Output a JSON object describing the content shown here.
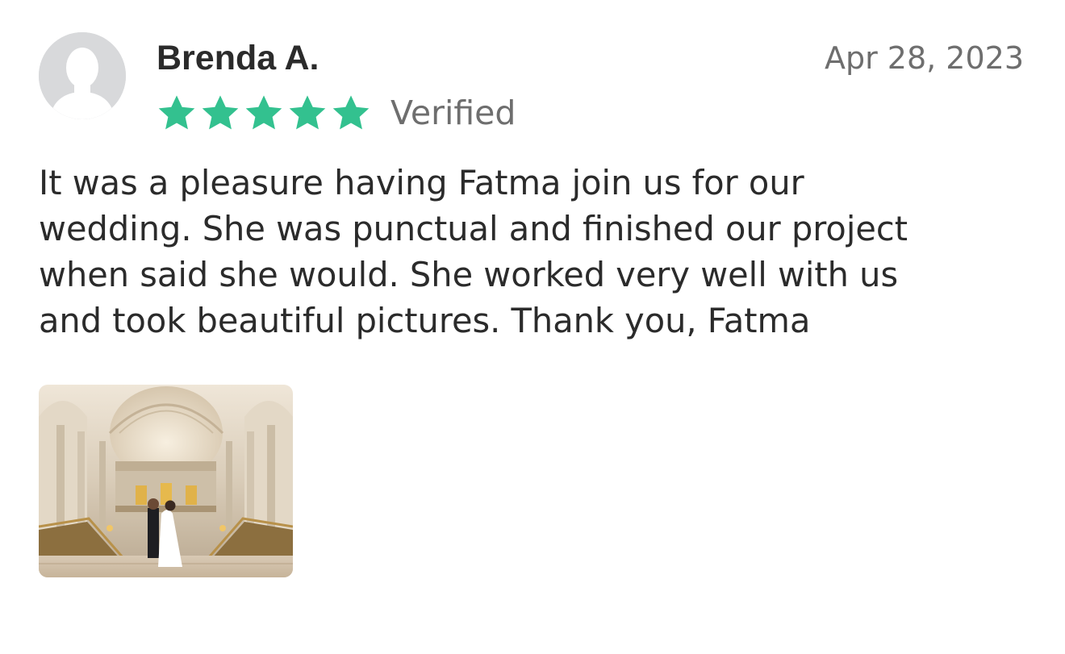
{
  "review": {
    "reviewer_name": "Brenda A.",
    "date": "Apr 28, 2023",
    "rating": 5,
    "rating_max": 5,
    "verified_label": "Verified",
    "text": "It was a pleasure having Fatma join us for our\nwedding.  She was punctual and finished our project\nwhen said she would.  She worked very well with us\nand took beautiful pictures.  Thank you, Fatma",
    "photo": {
      "icon": "wedding-photo-thumbnail"
    }
  },
  "colors": {
    "star": "#33c18f",
    "avatar_bg": "#d8d9db",
    "avatar_silhouette": "#ffffff",
    "text_primary": "#2b2b2b",
    "text_secondary": "#6e6e6e"
  }
}
